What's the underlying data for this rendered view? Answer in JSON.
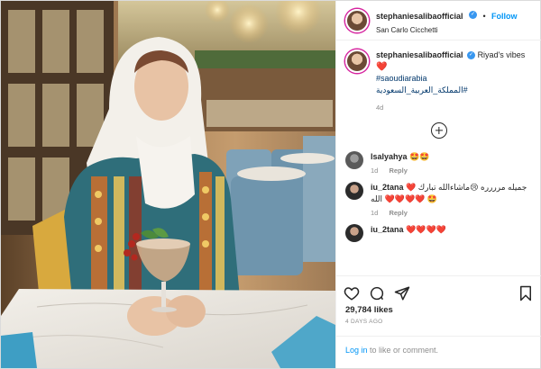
{
  "post": {
    "username": "stephaniesalibaofficial",
    "follow_label": "Follow",
    "location": "San Carlo Cicchetti",
    "caption": {
      "text": "Riyad's vibes",
      "hashtags": [
        "#saoudiarabia",
        "#المملكة_العربية_السعودية"
      ],
      "age": "4d"
    },
    "comments": [
      {
        "username": "lsalyahya",
        "text": "🤩🤩",
        "age": "1d",
        "reply_label": "Reply"
      },
      {
        "username": "iu_2tana",
        "text": "جميله مرررره 😢ماشاءالله تبارك ❤️❤️❤️❤️❤️ الله 🤩",
        "age": "1d",
        "reply_label": "Reply"
      },
      {
        "username": "iu_2tana",
        "text": "❤️❤️❤️❤️",
        "age": "",
        "reply_label": ""
      }
    ],
    "likes": "29,784 likes",
    "posted_ago": "4 DAYS AGO",
    "login_prompt": {
      "link": "Log in",
      "rest": " to like or comment."
    }
  },
  "icons": {
    "verified": "verified-badge-icon",
    "heart": "heart-icon",
    "comment": "comment-icon",
    "share": "share-icon",
    "save": "bookmark-icon",
    "load_more": "plus-circle-icon"
  },
  "colors": {
    "link": "#00376b",
    "follow": "#0095f6",
    "verified": "#3897f0",
    "heart": "#ed4956"
  }
}
